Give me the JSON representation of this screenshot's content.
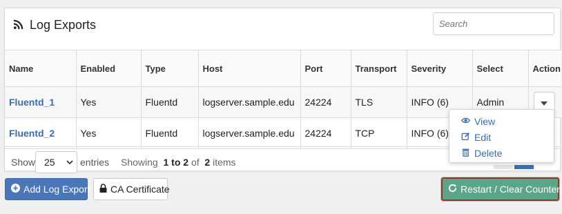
{
  "header": {
    "title": "Log Exports",
    "search_placeholder": "Search"
  },
  "table": {
    "columns": [
      "Name",
      "Enabled",
      "Type",
      "Host",
      "Port",
      "Transport",
      "Severity",
      "Select",
      "Action"
    ],
    "rows": [
      {
        "name": "Fluentd_1",
        "enabled": "Yes",
        "type": "Fluentd",
        "host": "logserver.sample.edu",
        "port": "24224",
        "transport": "TLS",
        "severity": "INFO (6)",
        "select": "Admin"
      },
      {
        "name": "Fluentd_2",
        "enabled": "Yes",
        "type": "Fluentd",
        "host": "logserver.sample.edu",
        "port": "24224",
        "transport": "TCP",
        "severity": "INFO (6)",
        "select": ""
      }
    ]
  },
  "footer": {
    "show_label": "Show",
    "entries_value": "25",
    "entries_label": "entries",
    "showing_prefix": "Showing",
    "range": "1 to 2",
    "of": "of",
    "total": "2",
    "items": "items"
  },
  "action_menu": {
    "items": [
      {
        "label": "View",
        "icon": "eye-icon"
      },
      {
        "label": "Edit",
        "icon": "edit-icon"
      },
      {
        "label": "Delete",
        "icon": "trash-icon"
      }
    ]
  },
  "buttons": {
    "add_label": "Add Log Export",
    "ca_label": "CA Certificate",
    "restart_label": "Restart / Clear Counters"
  },
  "colors": {
    "primary": "#4a76bb",
    "link": "#3a6db0",
    "success": "#5ba58a",
    "highlight_border": "#8b3a22"
  }
}
